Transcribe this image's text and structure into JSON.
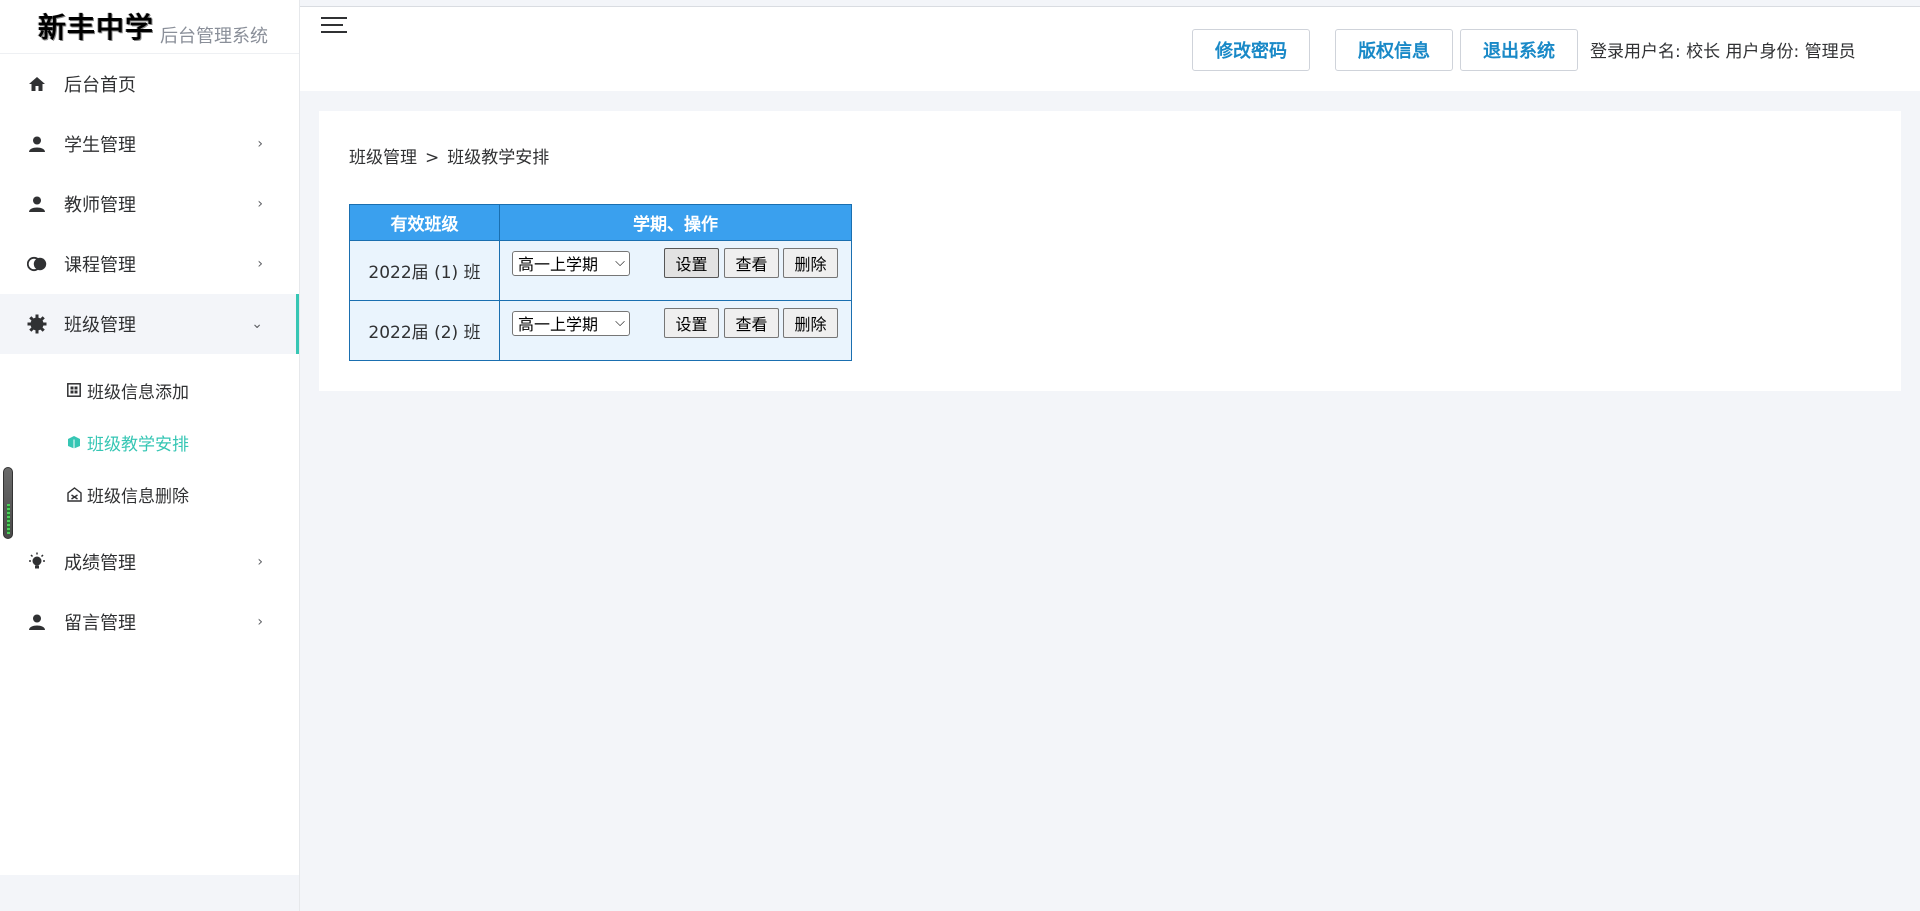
{
  "brand": {
    "school_name": "新丰中学",
    "system_name": "后台管理系统"
  },
  "sidebar": {
    "items": [
      {
        "label": "后台首页",
        "icon": "home-icon"
      },
      {
        "label": "学生管理",
        "icon": "user-icon"
      },
      {
        "label": "教师管理",
        "icon": "user-icon"
      },
      {
        "label": "课程管理",
        "icon": "course-icon"
      },
      {
        "label": "班级管理",
        "icon": "gear-icon",
        "expanded": true
      },
      {
        "label": "成绩管理",
        "icon": "bulb-icon"
      },
      {
        "label": "留言管理",
        "icon": "user-icon"
      }
    ],
    "class_submenu": [
      {
        "label": "班级信息添加",
        "icon": "add-grid-icon"
      },
      {
        "label": "班级教学安排",
        "icon": "book-icon",
        "active": true
      },
      {
        "label": "班级信息删除",
        "icon": "delete-icon"
      }
    ]
  },
  "header": {
    "btn_change_password": "修改密码",
    "btn_copyright": "版权信息",
    "btn_logout": "退出系统",
    "user_info": "登录用户名:  校长 用户身份:  管理员"
  },
  "breadcrumb": {
    "parent": "班级管理",
    "separator": ">",
    "current": "班级教学安排"
  },
  "table": {
    "headers": [
      "有效班级",
      "学期、操作"
    ],
    "rows": [
      {
        "class": "2022届 (1) 班",
        "term": "高一上学期"
      },
      {
        "class": "2022届 (2) 班",
        "term": "高一上学期"
      }
    ],
    "btn_set": "设置",
    "btn_view": "查看",
    "btn_delete": "删除"
  },
  "colors": {
    "accent": "#36c6b4",
    "header_button_text": "#1989c7",
    "table_header_bg": "#3aa0ee",
    "table_cell_bg": "#eaf4fd"
  }
}
